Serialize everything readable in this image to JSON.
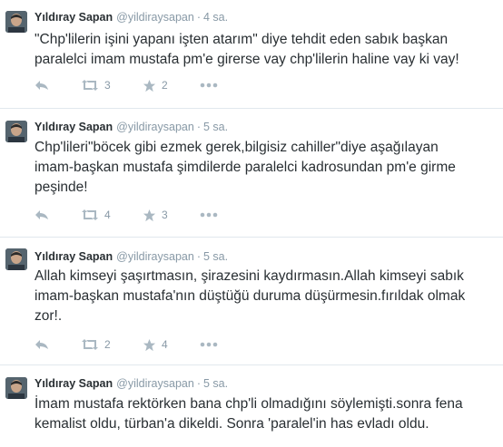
{
  "tweets": [
    {
      "name": "Yıldıray Sapan",
      "handle": "@yildiraysapan",
      "time": "4 sa.",
      "lines": [
        "\"Chp'lilerin işini yapanı işten atarım\" diye tehdit eden sabık başkan",
        "paralelci imam mustafa pm'e girerse vay chp'lilerin haline vay ki vay!"
      ],
      "retweets": "3",
      "favorites": "2"
    },
    {
      "name": "Yıldıray Sapan",
      "handle": "@yildiraysapan",
      "time": "5 sa.",
      "lines": [
        "Chp'lileri\"böcek gibi ezmek gerek,bilgisiz cahiller\"diye aşağılayan",
        "imam-başkan mustafa şimdilerde paralelci kadrosundan pm'e girme",
        "peşinde!"
      ],
      "retweets": "4",
      "favorites": "3"
    },
    {
      "name": "Yıldıray Sapan",
      "handle": "@yildiraysapan",
      "time": "5 sa.",
      "lines": [
        "Allah kimseyi şaşırtmasın, şirazesini kaydırmasın.Allah kimseyi sabık",
        "imam-başkan mustafa'nın düştüğü duruma düşürmesin.fırıldak olmak",
        "zor!."
      ],
      "retweets": "2",
      "favorites": "4"
    },
    {
      "name": "Yıldıray Sapan",
      "handle": "@yildiraysapan",
      "time": "5 sa.",
      "lines": [
        "İmam mustafa rektörken bana chp'li olmadığını söylemişti.sonra fena",
        "kemalist oldu, türban'a dikeldi. Sonra 'paralel'in has evladı oldu."
      ]
    }
  ],
  "icons": {
    "reply": "reply-icon",
    "retweet": "retweet-icon",
    "favorite": "star-icon",
    "more": "more-icon"
  },
  "colors": {
    "text": "#292f33",
    "muted": "#8899a6",
    "divider": "#e1e8ed"
  }
}
